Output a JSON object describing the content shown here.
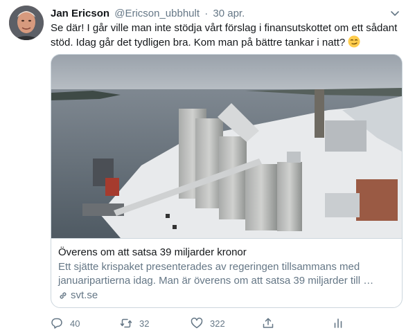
{
  "tweet": {
    "author": {
      "name": "Jan Ericson",
      "handle": "@Ericson_ubbhult",
      "avatar_icon": "user-avatar-photo"
    },
    "separator": "·",
    "date": "30 apr.",
    "text": "Se där! I går ville man inte stödja vårt förslag i finansutskottet om ett sådant stöd. Idag går det tydligen bra. Kom man på bättre tankar i natt?",
    "emoji": "smirking-face",
    "more_icon": "chevron-down-icon"
  },
  "card": {
    "image_alt": "industrial silos by the water in winter",
    "title": "Överens om att satsa 39 miljarder kronor",
    "description": "Ett sjätte krispaket presenterades av regeringen tillsammans med januaripartierna idag. Man är överens om att satsa 39 miljarder till …",
    "domain": "svt.se",
    "link_icon": "link-icon"
  },
  "actions": {
    "reply": {
      "icon": "reply-icon",
      "count": "40"
    },
    "retweet": {
      "icon": "retweet-icon",
      "count": "32"
    },
    "like": {
      "icon": "heart-icon",
      "count": "322"
    },
    "share": {
      "icon": "share-icon"
    },
    "analytics": {
      "icon": "analytics-icon"
    }
  },
  "colors": {
    "text": "#14171a",
    "secondary": "#657786",
    "border": "#ccd6dd"
  }
}
